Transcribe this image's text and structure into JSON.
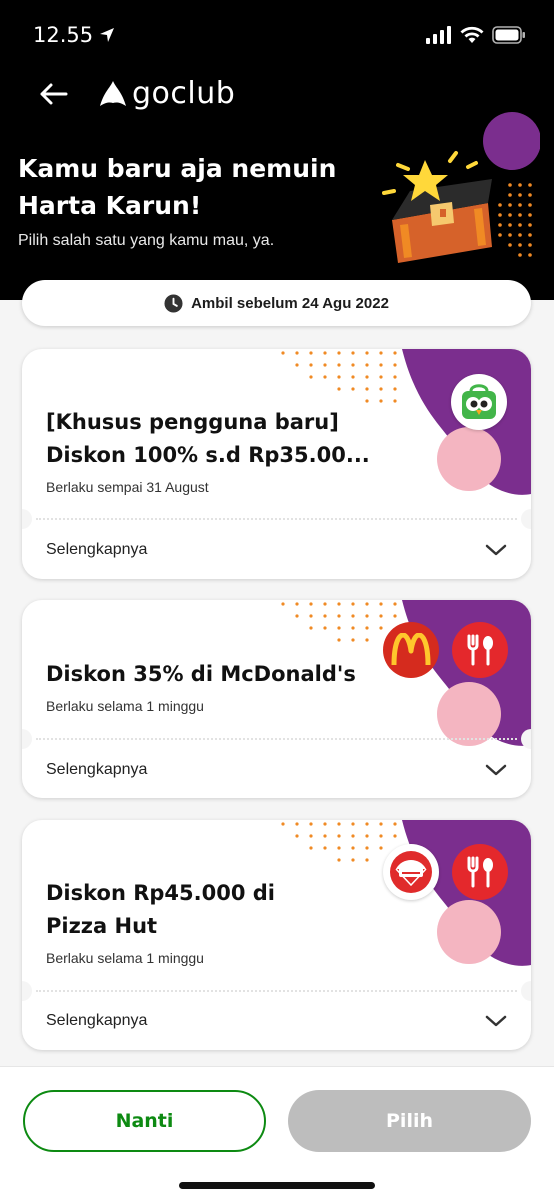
{
  "status_bar": {
    "time": "12.55"
  },
  "nav": {
    "brand": "goclub"
  },
  "hero": {
    "title_line1": "Kamu baru aja nemuin",
    "title_line2": "Harta Karun!",
    "subtitle": "Pilih salah satu yang kamu mau, ya."
  },
  "deadline": {
    "text": "Ambil sebelum 24 Agu 2022"
  },
  "vouchers": [
    {
      "title_line1": "[Khusus pengguna baru]",
      "title_line2": "Diskon 100% s.d Rp35.00...",
      "validity": "Berlaku sempai 31 August",
      "details_label": "Selengkapnya",
      "logos": [
        "tokopedia-logo"
      ]
    },
    {
      "title_line1": "Diskon 35% di McDonald's",
      "validity": "Berlaku selama 1 minggu",
      "details_label": "Selengkapnya",
      "logos": [
        "mcdonalds-logo",
        "food-icon"
      ]
    },
    {
      "title_line1": "Diskon Rp45.000 di",
      "title_line2": "Pizza Hut",
      "validity": "Berlaku selama 1 minggu",
      "details_label": "Selengkapnya",
      "logos": [
        "pizza-hut-logo",
        "food-icon"
      ]
    }
  ],
  "footer": {
    "later_label": "Nanti",
    "pick_label": "Pilih"
  },
  "colors": {
    "header_bg": "#000000",
    "accent_purple": "#7b2e8e",
    "accent_pink": "#f4b5c1",
    "accent_orange": "#f08a24",
    "primary_green": "#0d8a12",
    "disabled_gray": "#bdbdbd"
  }
}
